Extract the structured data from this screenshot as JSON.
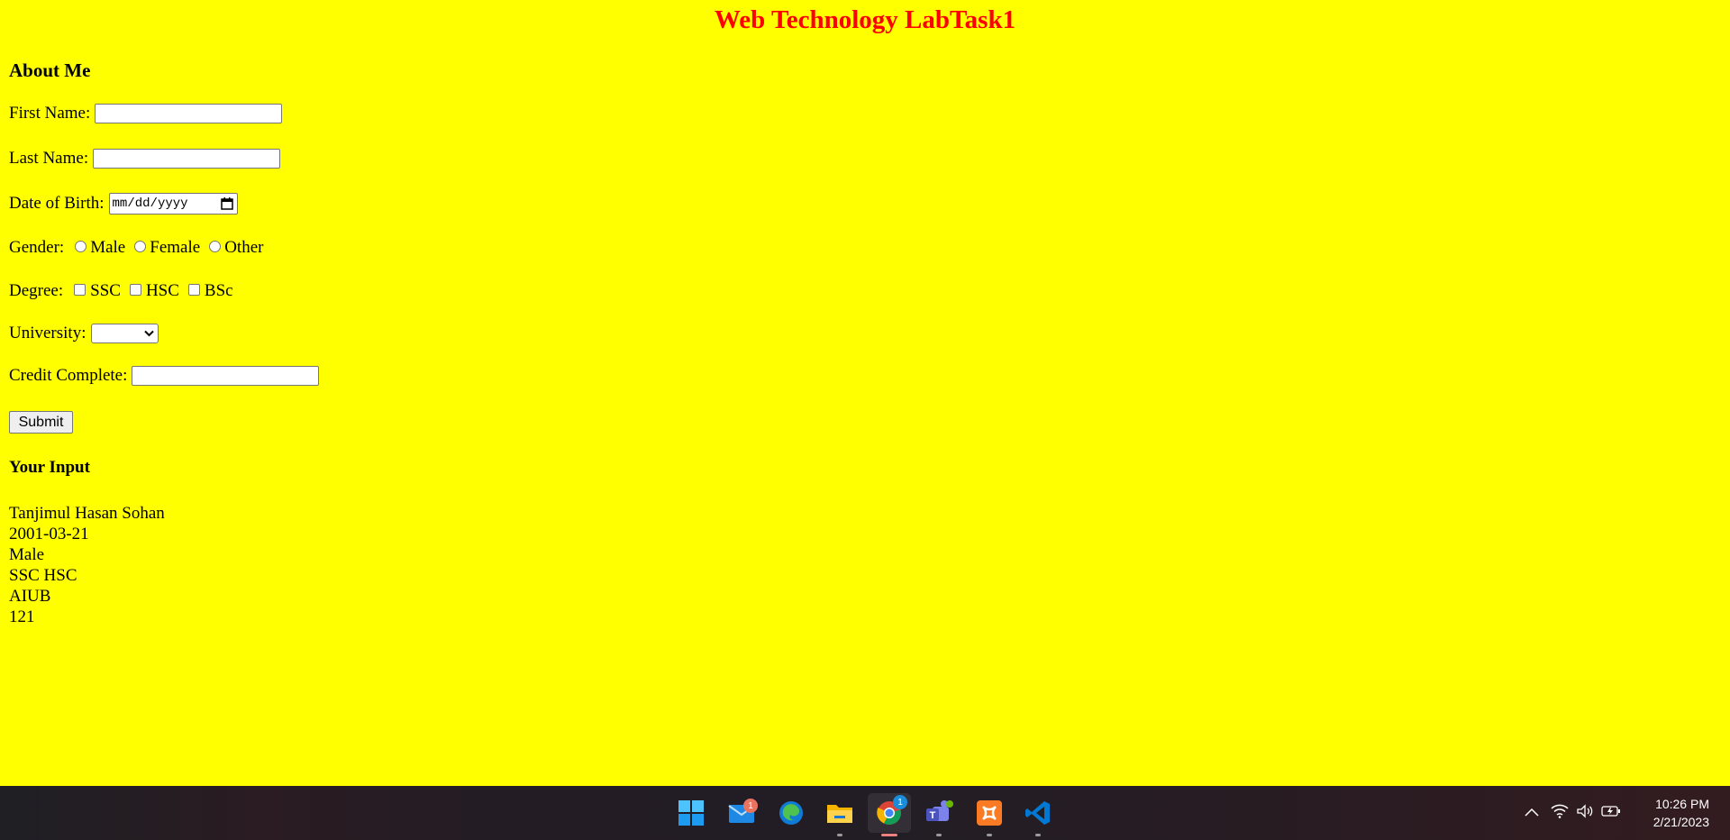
{
  "page": {
    "title": "Web Technology LabTask1",
    "about_heading": "About Me",
    "fields": {
      "first_name_label": "First Name:",
      "last_name_label": "Last Name:",
      "dob_label": "Date of Birth:",
      "dob_placeholder": "mm/dd/yyyy",
      "gender_label": "Gender:",
      "gender_options": [
        "Male",
        "Female",
        "Other"
      ],
      "degree_label": "Degree:",
      "degree_options": [
        "SSC",
        "HSC",
        "BSc"
      ],
      "university_label": "University:",
      "credit_label": "Credit Complete:"
    },
    "submit_label": "Submit",
    "output_heading": "Your Input",
    "output_lines": [
      "Tanjimul Hasan Sohan",
      "2001-03-21",
      "Male",
      "SSC HSC",
      "AIUB",
      "121"
    ]
  },
  "colors": {
    "background": "#ffff00",
    "title": "#ff0000"
  },
  "taskbar": {
    "apps": [
      {
        "name": "windows-start-icon"
      },
      {
        "name": "mail-icon",
        "badge": "1"
      },
      {
        "name": "edge-icon"
      },
      {
        "name": "file-explorer-icon"
      },
      {
        "name": "chrome-icon",
        "badge": "1"
      },
      {
        "name": "teams-icon"
      },
      {
        "name": "xampp-icon"
      },
      {
        "name": "vscode-icon"
      }
    ],
    "clock_time": "10:26 PM",
    "clock_date": "2/21/2023"
  }
}
